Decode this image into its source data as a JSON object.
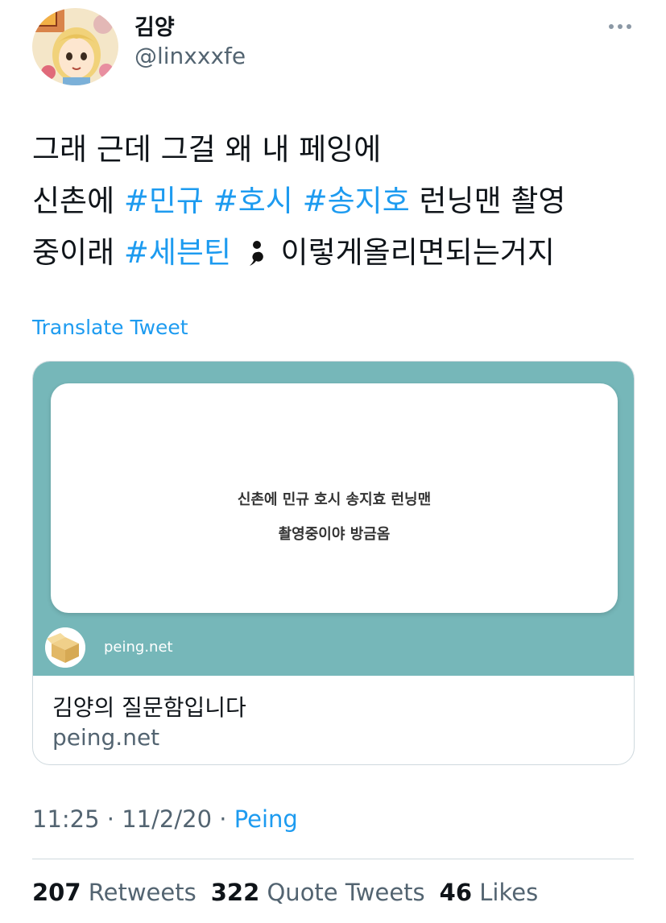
{
  "user": {
    "display_name": "김양",
    "handle": "@linxxxfe"
  },
  "tweet": {
    "lines": [
      [
        {
          "text": "그래 근데 그걸 왜 내 페잉에",
          "type": "text"
        }
      ],
      [
        {
          "text": "신촌에 ",
          "type": "text"
        },
        {
          "text": "#민규",
          "type": "hashtag"
        },
        {
          "text": " ",
          "type": "text"
        },
        {
          "text": "#호시",
          "type": "hashtag"
        },
        {
          "text": " ",
          "type": "text"
        },
        {
          "text": "#송지호",
          "type": "hashtag"
        },
        {
          "text": " 런닝맨 촬영",
          "type": "text"
        }
      ],
      [
        {
          "text": "중이래 ",
          "type": "text"
        },
        {
          "text": "#세븐틴",
          "type": "hashtag"
        },
        {
          "text": " ",
          "type": "text"
        },
        {
          "emoji": "semicolon-emoji",
          "type": "emoji"
        },
        {
          "text": " 이렇게올리면되는거지",
          "type": "text"
        }
      ]
    ],
    "translate_label": "Translate Tweet"
  },
  "card": {
    "question_line_1": "신촌에 민규 호시 송지효 런닝맨",
    "question_line_2": "촬영중이야 방금옴",
    "site_small": "peing.net",
    "title": "김양의 질문함입니다",
    "domain": "peing.net",
    "image_bg_color": "#76b7b9"
  },
  "meta": {
    "time": "11:25",
    "date": "11/2/20",
    "separator": " · ",
    "source": "Peing"
  },
  "stats": {
    "retweets_count": "207",
    "retweets_label": "Retweets",
    "quote_count": "322",
    "quote_label": "Quote Tweets",
    "likes_count": "46",
    "likes_label": "Likes"
  },
  "colors": {
    "accent": "#1d9bf0",
    "secondary_text": "#536471"
  }
}
